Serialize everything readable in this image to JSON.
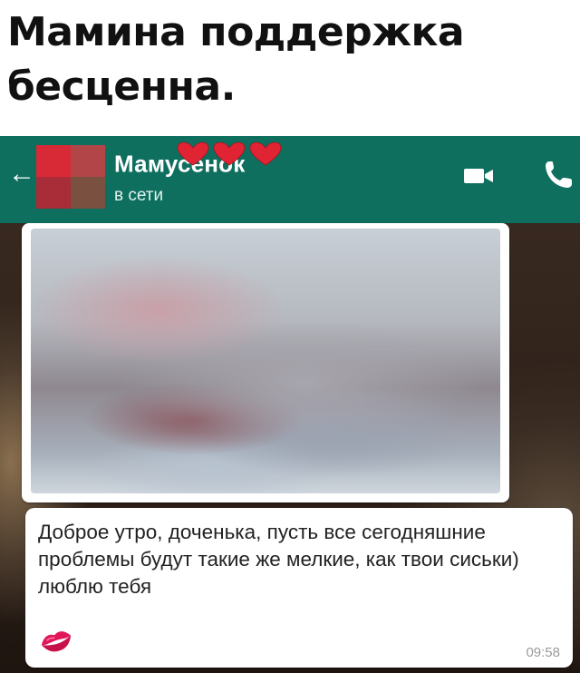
{
  "caption": "Мамина поддержка\nбесценна.",
  "header": {
    "contact_name": "Мамусенок",
    "contact_hearts": "❤️❤️❤️",
    "status": "в сети",
    "icons": [
      "back-arrow-icon",
      "avatar",
      "video-call-icon",
      "voice-call-icon"
    ]
  },
  "messages": [
    {
      "type": "image",
      "blurred": true
    },
    {
      "type": "text",
      "text": "Доброе утро, доченька, пусть все сегодняшние проблемы будут такие же мелкие, как твои сиськи) люблю тебя",
      "emoji": "💋",
      "time": "09:58"
    }
  ],
  "colors": {
    "header_bg": "#0f6f5f",
    "bubble_bg": "#ffffff",
    "heart": "#e02434"
  }
}
